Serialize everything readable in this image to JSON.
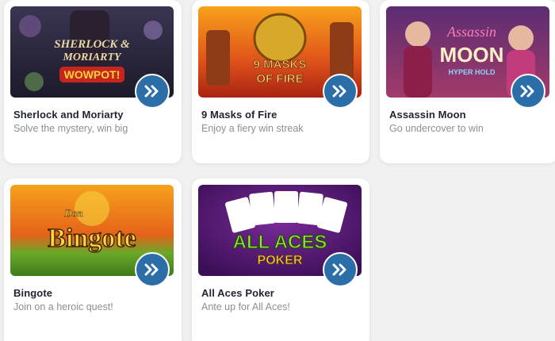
{
  "games": [
    {
      "title": "Sherlock and Moriarty",
      "description": "Solve the mystery, win big",
      "art_text": [
        "SHERLOCK &",
        "MORIARTY",
        "WOWPOT!"
      ]
    },
    {
      "title": "9 Masks of Fire",
      "description": "Enjoy a fiery win streak",
      "art_text": [
        "9 MASKS",
        "OF FIRE"
      ]
    },
    {
      "title": "Assassin Moon",
      "description": "Go undercover to win",
      "art_text": [
        "Assassin",
        "MOON",
        "HYPER HOLD"
      ]
    },
    {
      "title": "Bingote",
      "description": "Join on a heroic quest!",
      "art_text": [
        "Don",
        "Bingote"
      ]
    },
    {
      "title": "All Aces Poker",
      "description": "Ante up for All Aces!",
      "art_text": [
        "ALL ACES",
        "POKER"
      ]
    }
  ],
  "colors": {
    "play_button": "#2b6ea8",
    "title": "#1f2430",
    "description": "#8a8f98",
    "background": "#f1f1f1"
  },
  "icons": {
    "play": "double-chevron-right-icon"
  }
}
